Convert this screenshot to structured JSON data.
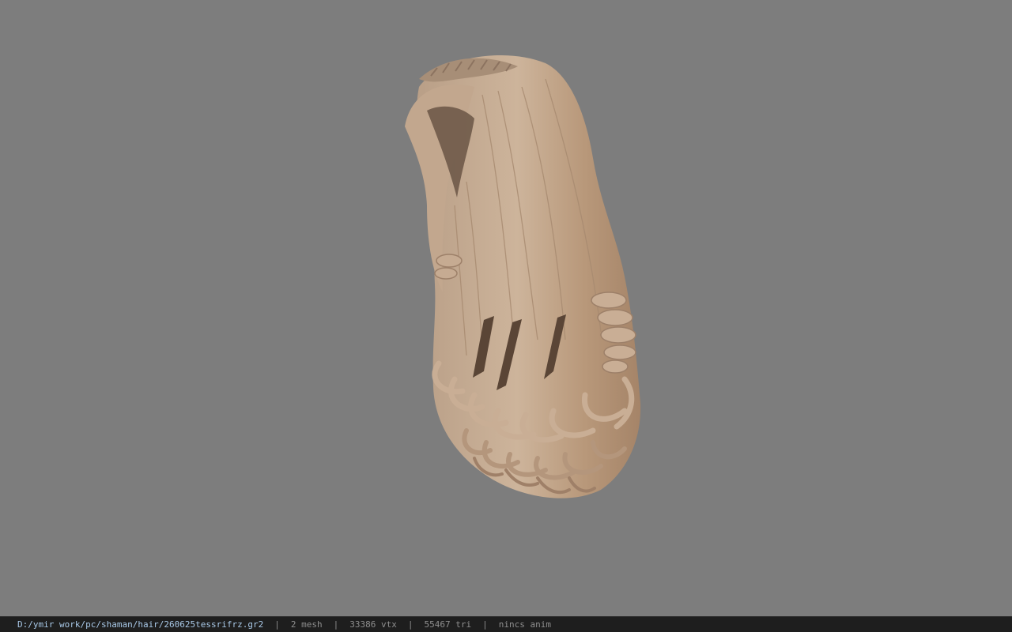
{
  "viewport": {
    "background": "#7d7d7d",
    "model": "long-wavy-braided-hair-mesh"
  },
  "statusbar": {
    "path": "D:/ymir work/pc/shaman/hair/260625tessrifrz.gr2",
    "separator": "|",
    "mesh": "2 mesh",
    "vtx": "33386 vtx",
    "tri": "55467 tri",
    "anim": "nincs anim"
  }
}
